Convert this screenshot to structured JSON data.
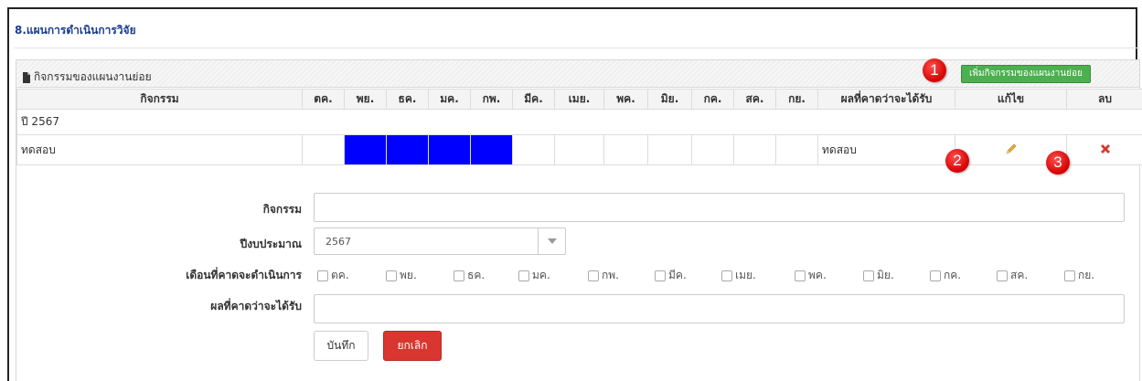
{
  "section": {
    "title": "8.แผนการดำเนินการวิจัย"
  },
  "panel": {
    "title": "กิจกรรมของแผนงานย่อย",
    "add_button_label": "เพิ่มกิจกรรมของแผนงานย่อย"
  },
  "callouts": [
    "1",
    "2",
    "3"
  ],
  "table": {
    "headers": {
      "activity": "กิจกรรม",
      "months": [
        "ตค.",
        "พย.",
        "ธค.",
        "มค.",
        "กพ.",
        "มีค.",
        "เมย.",
        "พค.",
        "มิย.",
        "กค.",
        "สค.",
        "กย."
      ],
      "expected": "ผลที่คาดว่าจะได้รับ",
      "edit": "แก้ไข",
      "delete": "ลบ"
    },
    "year_label": "ปี 2567",
    "rows": [
      {
        "activity": "ทดสอบ",
        "months_active": [
          false,
          true,
          true,
          true,
          true,
          false,
          false,
          false,
          false,
          false,
          false,
          false
        ],
        "expected": "ทดสอบ"
      }
    ],
    "active_color": "#0000ff"
  },
  "form": {
    "activity_label": "กิจกรรม",
    "activity_value": "",
    "budget_year_label": "ปีงบประมาณ",
    "budget_year_value": "2567",
    "months_label": "เดือนที่คาดจะดำเนินการ",
    "months": [
      "ตค.",
      "พย.",
      "ธค.",
      "มค.",
      "กพ.",
      "มีค.",
      "เมย.",
      "พค.",
      "มิย.",
      "กค.",
      "สค.",
      "กย."
    ],
    "expected_label": "ผลที่คาดว่าจะได้รับ",
    "expected_value": "",
    "save_label": "บันทึก",
    "cancel_label": "ยกเลิก"
  },
  "colors": {
    "title": "#1a3d8f",
    "add_button": "#4caf50",
    "cancel_button": "#d9362f",
    "callout": "#e00000",
    "delete_icon": "#d9362f"
  }
}
